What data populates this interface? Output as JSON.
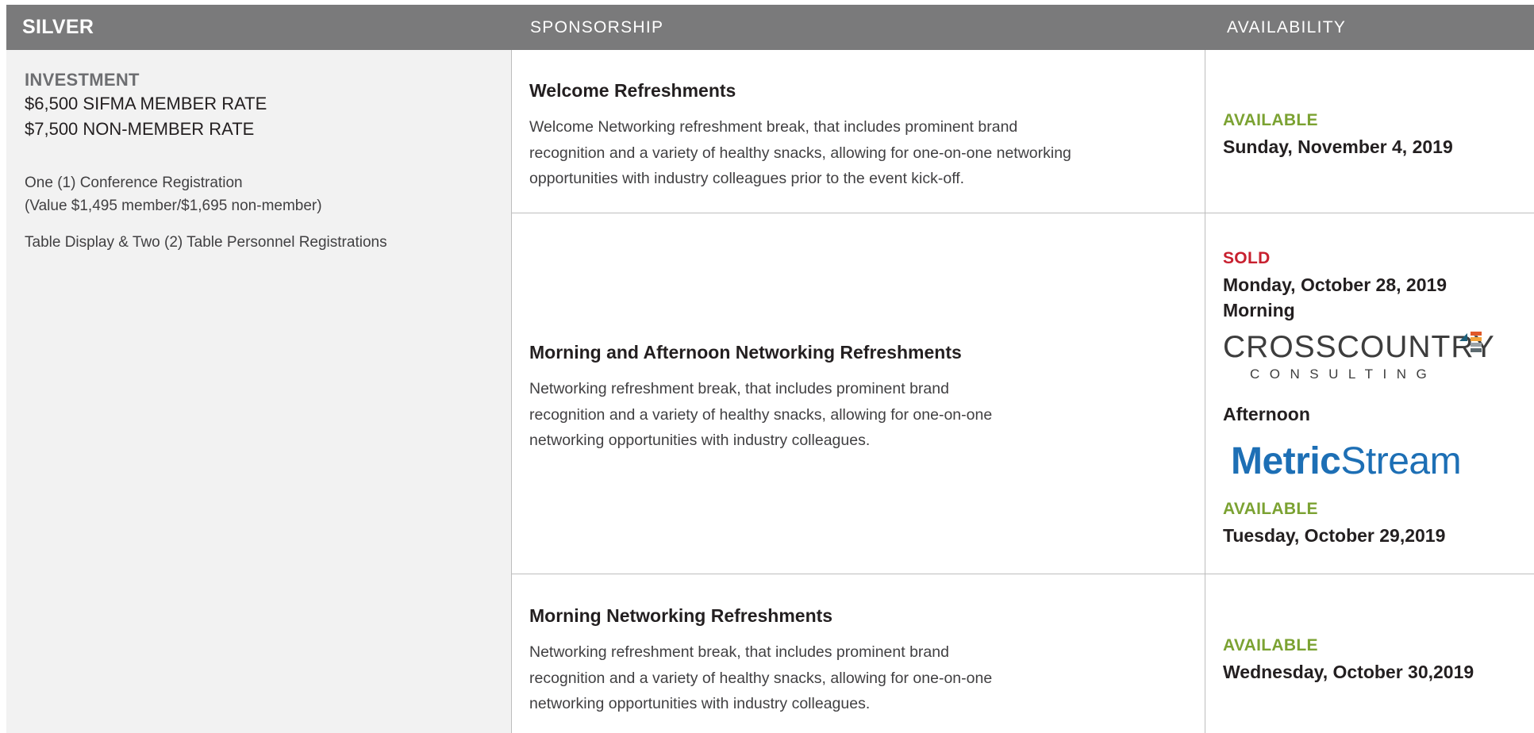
{
  "header": {
    "tier": "SILVER",
    "sponsorship": "SPONSORSHIP",
    "availability": "AVAILABILITY"
  },
  "investment": {
    "label": "INVESTMENT",
    "member_rate": "$6,500 SIFMA MEMBER RATE",
    "non_member_rate": "$7,500 NON-MEMBER RATE",
    "benefits": [
      "One (1) Conference Registration",
      "(Value $1,495 member/$1,695 non-member)",
      "Table Display & Two (2) Table Personnel Registrations"
    ]
  },
  "rows": [
    {
      "title": "Welcome Refreshments",
      "description": [
        "Welcome Networking refreshment break, that includes prominent brand",
        "recognition and a variety of healthy snacks, allowing for one-on-one networking",
        "opportunities with industry colleagues prior to the event kick-off."
      ],
      "status": "AVAILABLE",
      "date": "Sunday, November 4, 2019"
    },
    {
      "title": "Morning and Afternoon Networking Refreshments",
      "description": [
        "Networking refreshment break, that includes prominent brand",
        "recognition and a variety of healthy snacks, allowing for one-on-one",
        "networking opportunities with industry colleagues."
      ],
      "status_sold": "SOLD",
      "date_sold": "Monday, October 28, 2019",
      "morning": "Morning",
      "afternoon": "Afternoon",
      "logo_morning": {
        "main": "CROSSCOUNTRY",
        "sub": "CONSULTING"
      },
      "logo_afternoon": {
        "bold": "Metric",
        "light": "Stream"
      },
      "status_available": "AVAILABLE",
      "date_available": "Tuesday, October 29,2019"
    },
    {
      "title": "Morning Networking Refreshments",
      "description": [
        "Networking refreshment break, that includes prominent brand",
        "recognition and a variety of healthy snacks, allowing for one-on-one",
        "networking opportunities with industry colleagues."
      ],
      "status": "AVAILABLE",
      "date": "Wednesday, October 30,2019"
    }
  ],
  "colors": {
    "header_bg": "#7a7a7b",
    "left_col_bg": "#f2f2f2",
    "available": "#7ba232",
    "sold": "#c8202f",
    "metricstream": "#1d6fb5"
  }
}
